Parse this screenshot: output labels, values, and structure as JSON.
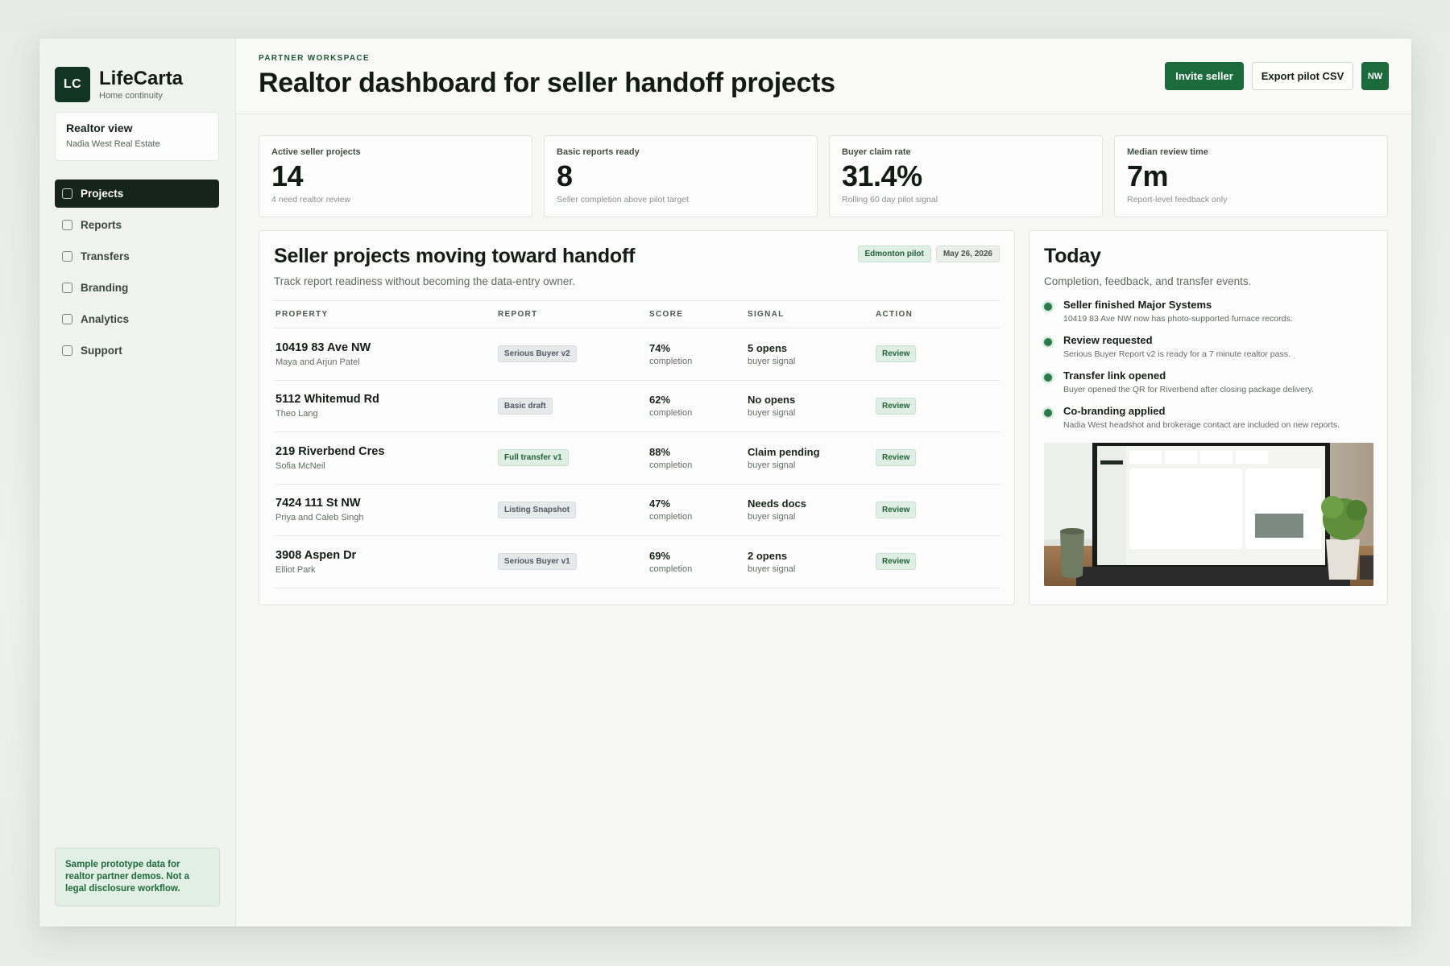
{
  "brand": {
    "logo": "LC",
    "name": "LifeCarta",
    "tagline": "Home continuity"
  },
  "view": {
    "title": "Realtor view",
    "org": "Nadia West Real Estate"
  },
  "nav": [
    {
      "label": "Projects",
      "active": true
    },
    {
      "label": "Reports",
      "active": false
    },
    {
      "label": "Transfers",
      "active": false
    },
    {
      "label": "Branding",
      "active": false
    },
    {
      "label": "Analytics",
      "active": false
    },
    {
      "label": "Support",
      "active": false
    }
  ],
  "notice": "Sample prototype data for realtor partner demos. Not a legal disclosure workflow.",
  "header": {
    "eyebrow": "PARTNER WORKSPACE",
    "title": "Realtor dashboard for seller handoff projects",
    "invite_label": "Invite seller",
    "export_label": "Export pilot CSV",
    "avatar": "NW"
  },
  "kpis": [
    {
      "label": "Active seller projects",
      "value": "14",
      "note": "4 need realtor review"
    },
    {
      "label": "Basic reports ready",
      "value": "8",
      "note": "Seller completion above pilot target"
    },
    {
      "label": "Buyer claim rate",
      "value": "31.4%",
      "note": "Rolling 60 day pilot signal"
    },
    {
      "label": "Median review time",
      "value": "7m",
      "note": "Report-level feedback only"
    }
  ],
  "projects": {
    "title": "Seller projects moving toward handoff",
    "subtitle": "Track report readiness without becoming the data-entry owner.",
    "chips": [
      "Edmonton pilot",
      "May 26, 2026"
    ],
    "columns": [
      "PROPERTY",
      "REPORT",
      "SCORE",
      "SIGNAL",
      "ACTION"
    ],
    "rows": [
      {
        "property": "10419 83 Ave NW",
        "owner": "Maya and Arjun Patel",
        "report": "Serious Buyer v2",
        "report_style": "gray",
        "score": "74%",
        "score_sub": "completion",
        "signal": "5 opens",
        "signal_sub": "buyer signal",
        "action": "Review"
      },
      {
        "property": "5112 Whitemud Rd",
        "owner": "Theo Lang",
        "report": "Basic draft",
        "report_style": "gray",
        "score": "62%",
        "score_sub": "completion",
        "signal": "No opens",
        "signal_sub": "buyer signal",
        "action": "Review"
      },
      {
        "property": "219 Riverbend Cres",
        "owner": "Sofia McNeil",
        "report": "Full transfer v1",
        "report_style": "green",
        "score": "88%",
        "score_sub": "completion",
        "signal": "Claim pending",
        "signal_sub": "buyer signal",
        "action": "Review"
      },
      {
        "property": "7424 111 St NW",
        "owner": "Priya and Caleb Singh",
        "report": "Listing Snapshot",
        "report_style": "gray",
        "score": "47%",
        "score_sub": "completion",
        "signal": "Needs docs",
        "signal_sub": "buyer signal",
        "action": "Review"
      },
      {
        "property": "3908 Aspen Dr",
        "owner": "Elliot Park",
        "report": "Serious Buyer v1",
        "report_style": "gray",
        "score": "69%",
        "score_sub": "completion",
        "signal": "2 opens",
        "signal_sub": "buyer signal",
        "action": "Review"
      }
    ]
  },
  "today": {
    "title": "Today",
    "subtitle": "Completion, feedback, and transfer events.",
    "events": [
      {
        "title": "Seller finished Major Systems",
        "desc": "10419 83 Ave NW now has photo-supported furnace records."
      },
      {
        "title": "Review requested",
        "desc": "Serious Buyer Report v2 is ready for a 7 minute realtor pass."
      },
      {
        "title": "Transfer link opened",
        "desc": "Buyer opened the QR for Riverbend after closing package delivery."
      },
      {
        "title": "Co-branding applied",
        "desc": "Nadia West headshot and brokerage contact are included on new reports."
      }
    ]
  },
  "colors": {
    "brand_dark": "#123524",
    "accent_green": "#1c6b3c",
    "nav_active": "#15251c"
  }
}
